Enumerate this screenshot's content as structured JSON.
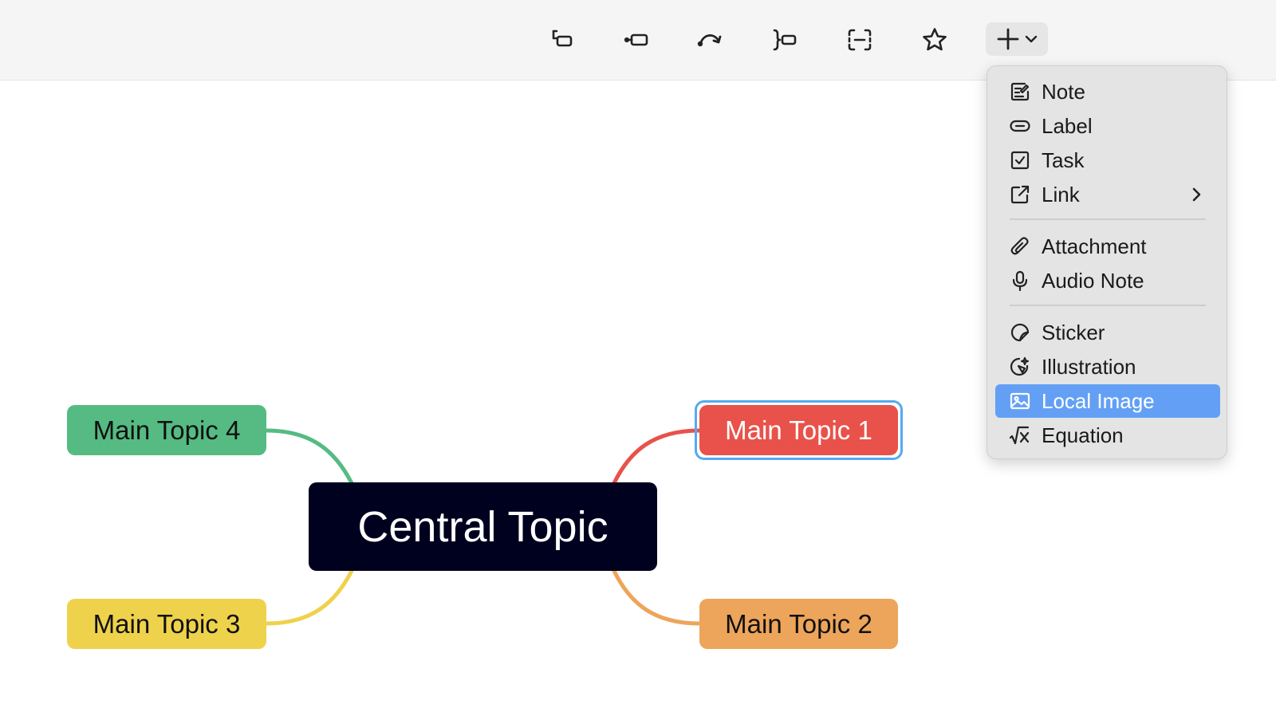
{
  "toolbar": {
    "buttons": [
      {
        "name": "subtopic-icon"
      },
      {
        "name": "topic-after-icon"
      },
      {
        "name": "relationship-icon"
      },
      {
        "name": "summary-icon"
      },
      {
        "name": "boundary-icon"
      },
      {
        "name": "star-icon"
      }
    ],
    "insert_icon": "plus-icon",
    "insert_dropdown_icon": "chevron-down-icon"
  },
  "mindmap": {
    "central": "Central Topic",
    "topics": [
      {
        "label": "Main Topic 1",
        "color": "#e8524a",
        "selected": true
      },
      {
        "label": "Main Topic 2",
        "color": "#eda55b"
      },
      {
        "label": "Main Topic 3",
        "color": "#eed24c"
      },
      {
        "label": "Main Topic 4",
        "color": "#55bb82"
      }
    ],
    "central_color": "#00001f",
    "selection_color": "#55aaf0"
  },
  "insert_menu": {
    "items": [
      {
        "label": "Note",
        "icon": "note-icon"
      },
      {
        "label": "Label",
        "icon": "label-icon"
      },
      {
        "label": "Task",
        "icon": "task-icon"
      },
      {
        "label": "Link",
        "icon": "link-icon",
        "submenu": true
      },
      {
        "label": "Attachment",
        "icon": "attachment-icon"
      },
      {
        "label": "Audio Note",
        "icon": "microphone-icon"
      },
      {
        "label": "Sticker",
        "icon": "sticker-icon"
      },
      {
        "label": "Illustration",
        "icon": "illustration-icon"
      },
      {
        "label": "Local Image",
        "icon": "image-icon",
        "active": true
      },
      {
        "label": "Equation",
        "icon": "equation-icon"
      }
    ],
    "active_color": "#63a0f5"
  }
}
